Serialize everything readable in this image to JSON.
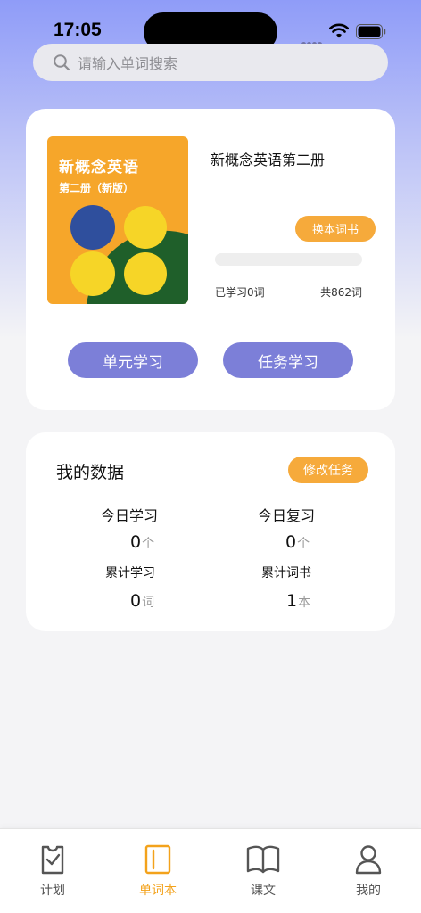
{
  "status_bar": {
    "time": "17:05"
  },
  "search": {
    "placeholder": "请输入单词搜索"
  },
  "book_card": {
    "cover": {
      "title": "新概念英语",
      "subtitle": "第二册（新版）"
    },
    "book_title": "新概念英语第二册",
    "change_book_label": "换本词书",
    "progress": 0,
    "learned_text": "已学习0词",
    "total_text": "共862词",
    "unit_study_label": "单元学习",
    "task_study_label": "任务学习"
  },
  "my_data": {
    "title": "我的数据",
    "modify_label": "修改任务",
    "stats": {
      "today_study": {
        "label": "今日学习",
        "value": "0",
        "unit": "个"
      },
      "today_review": {
        "label": "今日复习",
        "value": "0",
        "unit": "个"
      },
      "total_study": {
        "label": "累计学习",
        "value": "0",
        "unit": "词"
      },
      "total_books": {
        "label": "累计词书",
        "value": "1",
        "unit": "本"
      }
    }
  },
  "tabs": [
    {
      "label": "计划",
      "icon": "clipboard-check-icon"
    },
    {
      "label": "单词本",
      "icon": "notebook-icon",
      "active": true
    },
    {
      "label": "课文",
      "icon": "open-book-icon"
    },
    {
      "label": "我的",
      "icon": "person-icon"
    }
  ],
  "colors": {
    "accent_orange": "#f6aa3b",
    "accent_purple": "#7c7fd8",
    "cover_orange": "#f6a62a",
    "cover_green": "#1f5f2a",
    "cover_yellow": "#f6d527",
    "cover_blue": "#2f4f9d"
  }
}
